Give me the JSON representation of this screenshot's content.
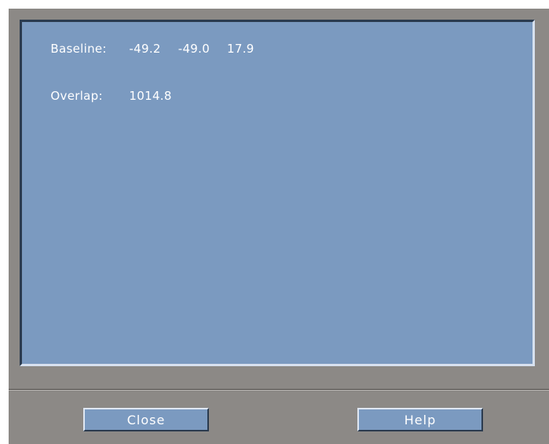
{
  "output": {
    "baseline": {
      "label": "Baseline:",
      "values": [
        "-49.2",
        "-49.0",
        "17.9"
      ]
    },
    "overlap": {
      "label": "Overlap:",
      "value": "1014.8"
    }
  },
  "buttons": {
    "close_label": "Close",
    "help_label": "Help"
  },
  "colors": {
    "dialog_bg": "#8c8986",
    "panel_bg": "#7b9ac0",
    "text": "#ffffff"
  }
}
